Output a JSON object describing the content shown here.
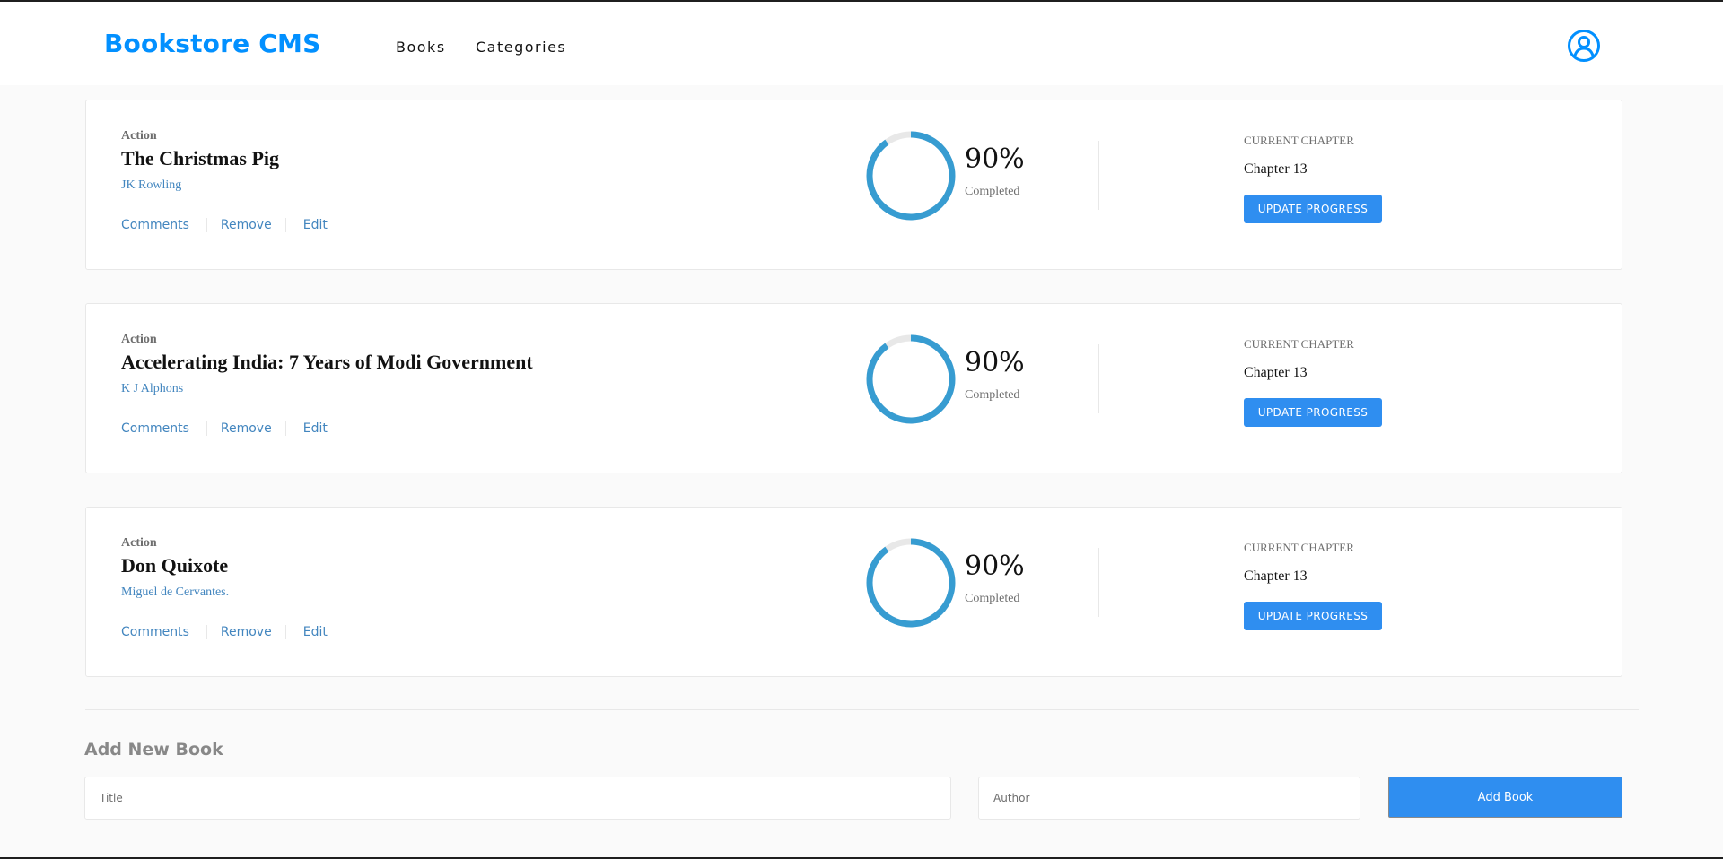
{
  "header": {
    "brand": "Bookstore CMS",
    "nav": [
      "Books",
      "Categories"
    ],
    "user_icon": "user-circle-icon"
  },
  "books": [
    {
      "genre": "Action",
      "title": "The Christmas Pig",
      "author": "JK Rowling",
      "actions": [
        "Comments",
        "Remove",
        "Edit"
      ],
      "progress_percent": 90,
      "progress_label": "90%",
      "completed_label": "Completed",
      "current_chapter_label": "CURRENT CHAPTER",
      "current_chapter": "Chapter 13",
      "update_button": "UPDATE PROGRESS"
    },
    {
      "genre": "Action",
      "title": "Accelerating India: 7 Years of Modi Government",
      "author": "K J Alphons",
      "actions": [
        "Comments",
        "Remove",
        "Edit"
      ],
      "progress_percent": 90,
      "progress_label": "90%",
      "completed_label": "Completed",
      "current_chapter_label": "CURRENT CHAPTER",
      "current_chapter": "Chapter 13",
      "update_button": "UPDATE PROGRESS"
    },
    {
      "genre": "Action",
      "title": "Don Quixote",
      "author": "Miguel de Cervantes.",
      "actions": [
        "Comments",
        "Remove",
        "Edit"
      ],
      "progress_percent": 90,
      "progress_label": "90%",
      "completed_label": "Completed",
      "current_chapter_label": "CURRENT CHAPTER",
      "current_chapter": "Chapter 13",
      "update_button": "UPDATE PROGRESS"
    }
  ],
  "form": {
    "heading": "Add New Book",
    "title_placeholder": "Title",
    "author_placeholder": "Author",
    "submit_label": "Add Book"
  },
  "colors": {
    "brand": "#0290ff",
    "accent": "#2f8ef0",
    "progress": "#379cd1",
    "progress_track": "#e8e8e8",
    "link": "#4386bf"
  }
}
